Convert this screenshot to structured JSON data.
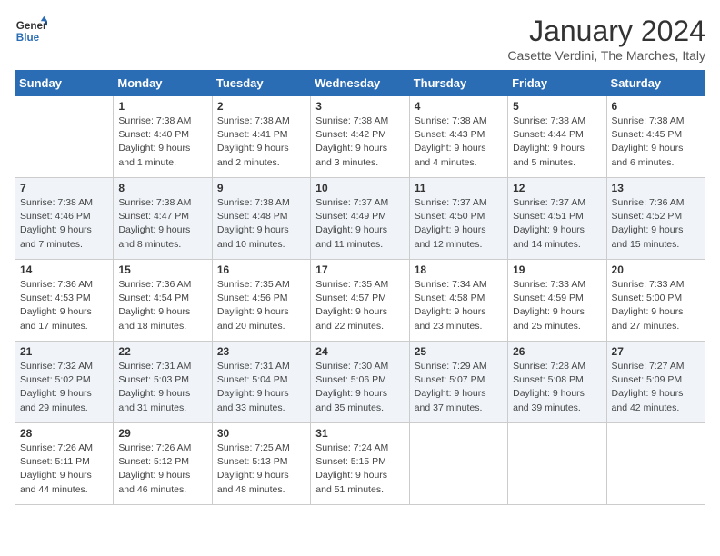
{
  "logo": {
    "line1": "General",
    "line2": "Blue"
  },
  "title": "January 2024",
  "location": "Casette Verdini, The Marches, Italy",
  "weekdays": [
    "Sunday",
    "Monday",
    "Tuesday",
    "Wednesday",
    "Thursday",
    "Friday",
    "Saturday"
  ],
  "weeks": [
    [
      {
        "day": "",
        "sunrise": "",
        "sunset": "",
        "daylight": ""
      },
      {
        "day": "1",
        "sunrise": "7:38 AM",
        "sunset": "4:40 PM",
        "daylight": "9 hours and 1 minute."
      },
      {
        "day": "2",
        "sunrise": "7:38 AM",
        "sunset": "4:41 PM",
        "daylight": "9 hours and 2 minutes."
      },
      {
        "day": "3",
        "sunrise": "7:38 AM",
        "sunset": "4:42 PM",
        "daylight": "9 hours and 3 minutes."
      },
      {
        "day": "4",
        "sunrise": "7:38 AM",
        "sunset": "4:43 PM",
        "daylight": "9 hours and 4 minutes."
      },
      {
        "day": "5",
        "sunrise": "7:38 AM",
        "sunset": "4:44 PM",
        "daylight": "9 hours and 5 minutes."
      },
      {
        "day": "6",
        "sunrise": "7:38 AM",
        "sunset": "4:45 PM",
        "daylight": "9 hours and 6 minutes."
      }
    ],
    [
      {
        "day": "7",
        "sunrise": "7:38 AM",
        "sunset": "4:46 PM",
        "daylight": "9 hours and 7 minutes."
      },
      {
        "day": "8",
        "sunrise": "7:38 AM",
        "sunset": "4:47 PM",
        "daylight": "9 hours and 8 minutes."
      },
      {
        "day": "9",
        "sunrise": "7:38 AM",
        "sunset": "4:48 PM",
        "daylight": "9 hours and 10 minutes."
      },
      {
        "day": "10",
        "sunrise": "7:37 AM",
        "sunset": "4:49 PM",
        "daylight": "9 hours and 11 minutes."
      },
      {
        "day": "11",
        "sunrise": "7:37 AM",
        "sunset": "4:50 PM",
        "daylight": "9 hours and 12 minutes."
      },
      {
        "day": "12",
        "sunrise": "7:37 AM",
        "sunset": "4:51 PM",
        "daylight": "9 hours and 14 minutes."
      },
      {
        "day": "13",
        "sunrise": "7:36 AM",
        "sunset": "4:52 PM",
        "daylight": "9 hours and 15 minutes."
      }
    ],
    [
      {
        "day": "14",
        "sunrise": "7:36 AM",
        "sunset": "4:53 PM",
        "daylight": "9 hours and 17 minutes."
      },
      {
        "day": "15",
        "sunrise": "7:36 AM",
        "sunset": "4:54 PM",
        "daylight": "9 hours and 18 minutes."
      },
      {
        "day": "16",
        "sunrise": "7:35 AM",
        "sunset": "4:56 PM",
        "daylight": "9 hours and 20 minutes."
      },
      {
        "day": "17",
        "sunrise": "7:35 AM",
        "sunset": "4:57 PM",
        "daylight": "9 hours and 22 minutes."
      },
      {
        "day": "18",
        "sunrise": "7:34 AM",
        "sunset": "4:58 PM",
        "daylight": "9 hours and 23 minutes."
      },
      {
        "day": "19",
        "sunrise": "7:33 AM",
        "sunset": "4:59 PM",
        "daylight": "9 hours and 25 minutes."
      },
      {
        "day": "20",
        "sunrise": "7:33 AM",
        "sunset": "5:00 PM",
        "daylight": "9 hours and 27 minutes."
      }
    ],
    [
      {
        "day": "21",
        "sunrise": "7:32 AM",
        "sunset": "5:02 PM",
        "daylight": "9 hours and 29 minutes."
      },
      {
        "day": "22",
        "sunrise": "7:31 AM",
        "sunset": "5:03 PM",
        "daylight": "9 hours and 31 minutes."
      },
      {
        "day": "23",
        "sunrise": "7:31 AM",
        "sunset": "5:04 PM",
        "daylight": "9 hours and 33 minutes."
      },
      {
        "day": "24",
        "sunrise": "7:30 AM",
        "sunset": "5:06 PM",
        "daylight": "9 hours and 35 minutes."
      },
      {
        "day": "25",
        "sunrise": "7:29 AM",
        "sunset": "5:07 PM",
        "daylight": "9 hours and 37 minutes."
      },
      {
        "day": "26",
        "sunrise": "7:28 AM",
        "sunset": "5:08 PM",
        "daylight": "9 hours and 39 minutes."
      },
      {
        "day": "27",
        "sunrise": "7:27 AM",
        "sunset": "5:09 PM",
        "daylight": "9 hours and 42 minutes."
      }
    ],
    [
      {
        "day": "28",
        "sunrise": "7:26 AM",
        "sunset": "5:11 PM",
        "daylight": "9 hours and 44 minutes."
      },
      {
        "day": "29",
        "sunrise": "7:26 AM",
        "sunset": "5:12 PM",
        "daylight": "9 hours and 46 minutes."
      },
      {
        "day": "30",
        "sunrise": "7:25 AM",
        "sunset": "5:13 PM",
        "daylight": "9 hours and 48 minutes."
      },
      {
        "day": "31",
        "sunrise": "7:24 AM",
        "sunset": "5:15 PM",
        "daylight": "9 hours and 51 minutes."
      },
      {
        "day": "",
        "sunrise": "",
        "sunset": "",
        "daylight": ""
      },
      {
        "day": "",
        "sunrise": "",
        "sunset": "",
        "daylight": ""
      },
      {
        "day": "",
        "sunrise": "",
        "sunset": "",
        "daylight": ""
      }
    ]
  ],
  "labels": {
    "sunrise": "Sunrise:",
    "sunset": "Sunset:",
    "daylight": "Daylight:"
  }
}
